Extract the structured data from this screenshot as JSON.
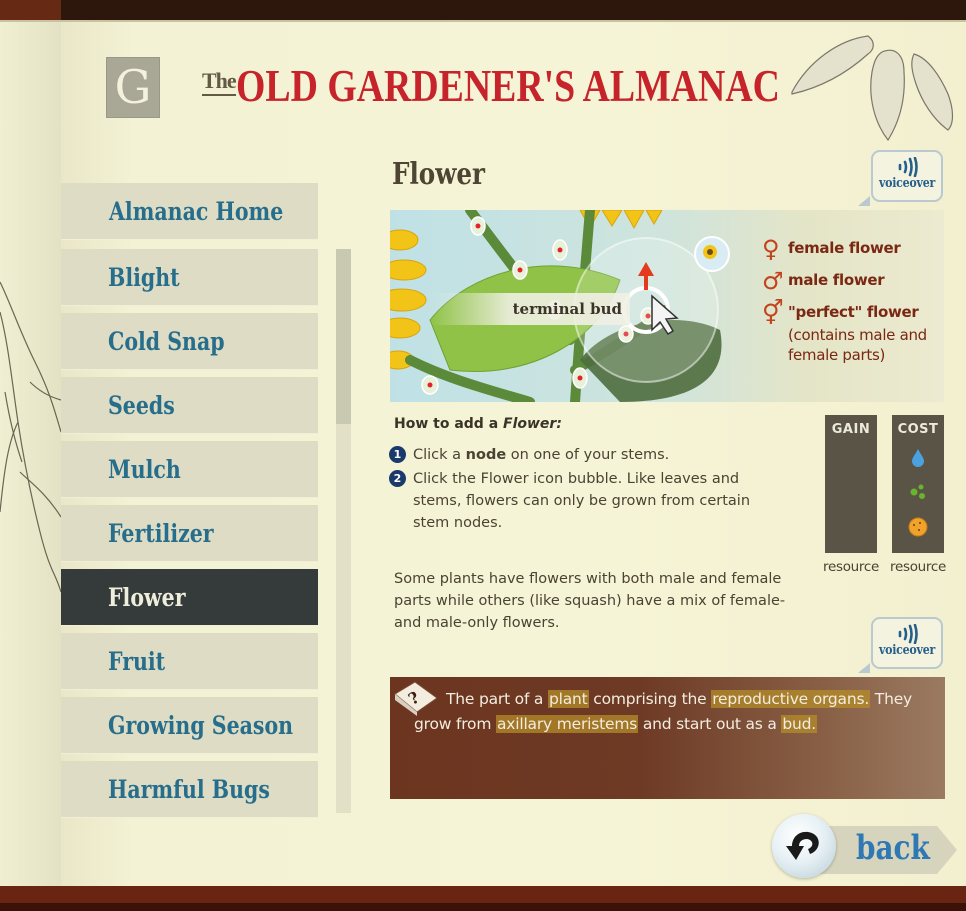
{
  "header": {
    "logo_letter": "G",
    "title_prefix": "The",
    "title": "OLD GARDENER'S ALMANAC"
  },
  "sidebar": {
    "home_label": "Almanac Home",
    "items": [
      {
        "label": "Blight",
        "active": false
      },
      {
        "label": "Cold Snap",
        "active": false
      },
      {
        "label": "Seeds",
        "active": false
      },
      {
        "label": "Mulch",
        "active": false
      },
      {
        "label": "Fertilizer",
        "active": false
      },
      {
        "label": "Flower",
        "active": true
      },
      {
        "label": "Fruit",
        "active": false
      },
      {
        "label": "Growing Season",
        "active": false
      },
      {
        "label": "Harmful Bugs",
        "active": false
      }
    ],
    "scroll_position_fraction": 0.0,
    "scroll_visible_fraction": 0.31
  },
  "content": {
    "title": "Flower",
    "voiceover_label": "voiceover",
    "illustration": {
      "bud_label": "terminal bud",
      "legend": [
        {
          "symbol": "♀",
          "label": "female flower"
        },
        {
          "symbol": "♂",
          "label": "male flower"
        },
        {
          "symbol": "⚥",
          "label": "\"perfect\" flower",
          "sub": "(contains male and female parts)"
        }
      ]
    },
    "howto": {
      "title_prefix": "How to add a ",
      "title_em": "Flower:",
      "steps": [
        {
          "num": "1",
          "before": "Click a ",
          "bold": "node",
          "after": " on one of your stems."
        },
        {
          "num": "2",
          "line1": "Click the Flower icon bubble. Like leaves and",
          "line2": "stems, flowers can only be grown from certain",
          "line3": "stem nodes."
        }
      ]
    },
    "paragraph": "Some plants have flowers with both male and female parts while others (like squash) have a mix of female- and male-only flowers.",
    "resources": {
      "gain": {
        "header": "GAIN",
        "label": "resource",
        "icons": []
      },
      "cost": {
        "header": "COST",
        "label": "resource",
        "icons": [
          "water-drop",
          "nutrients",
          "energy-sun"
        ]
      }
    },
    "definition": {
      "segments": [
        {
          "text": "The part of a ",
          "highlight": false
        },
        {
          "text": "plant",
          "highlight": true
        },
        {
          "text": " comprising the ",
          "highlight": false
        },
        {
          "text": "reproductive organs.",
          "highlight": true
        },
        {
          "text": " They grow from ",
          "highlight": false
        },
        {
          "text": "axillary meristems",
          "highlight": true
        },
        {
          "text": " and start out as a ",
          "highlight": false
        },
        {
          "text": "bud.",
          "highlight": true
        }
      ]
    },
    "back_label": "back"
  },
  "colors": {
    "title_red": "#c6242a",
    "nav_text": "#266e8c",
    "nav_active_bg": "#343b3a",
    "legend_text": "#7a2713",
    "highlight": "#b48c28",
    "step_badge": "#1b3a6c"
  }
}
